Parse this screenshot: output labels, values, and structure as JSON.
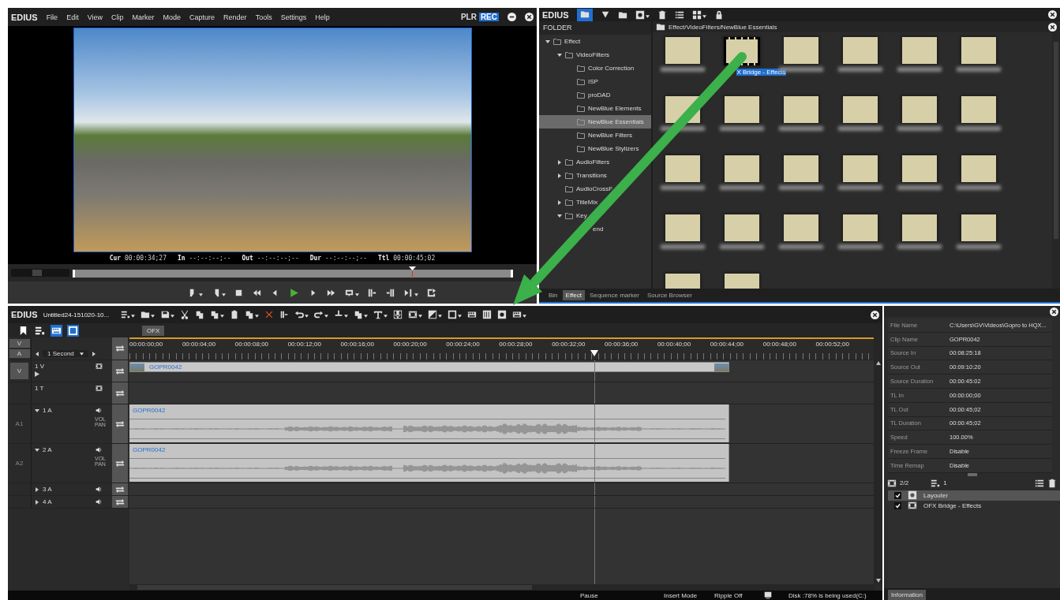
{
  "player": {
    "logo": "EDIUS",
    "menu": [
      "File",
      "Edit",
      "View",
      "Clip",
      "Marker",
      "Mode",
      "Capture",
      "Render",
      "Tools",
      "Settings",
      "Help"
    ],
    "modes": [
      {
        "label": "PLR",
        "selected": false
      },
      {
        "label": "REC",
        "selected": true
      }
    ],
    "timecodes": [
      {
        "label": "Cur",
        "value": "00:00:34;27"
      },
      {
        "label": "In",
        "value": "--:--:--;--"
      },
      {
        "label": "Out",
        "value": "--:--:--;--"
      },
      {
        "label": "Dur",
        "value": "--:--:--;--"
      },
      {
        "label": "Ttl",
        "value": "00:00:45;02"
      }
    ],
    "shuttle": {
      "level": 0.45
    },
    "scrubber": {
      "level": 0.77
    }
  },
  "bin": {
    "logo": "EDIUS",
    "folder_header": "FOLDER",
    "path": "Effect/VideoFilters/NewBlue Essentials",
    "tree": [
      {
        "label": "Effect",
        "expanded": true,
        "selected": false,
        "children": [
          {
            "label": "VideoFilters",
            "expanded": true,
            "selected": false,
            "children": [
              {
                "label": "Color Correction",
                "selected": false
              },
              {
                "label": "ISP",
                "selected": false
              },
              {
                "label": "proDAD",
                "selected": false
              },
              {
                "label": "NewBlue Elements",
                "selected": false
              },
              {
                "label": "NewBlue Essentials",
                "selected": true
              },
              {
                "label": "NewBlue Filters",
                "selected": false
              },
              {
                "label": "NewBlue Stylizers",
                "selected": false
              }
            ]
          },
          {
            "label": "AudioFilters",
            "expanded": false,
            "selected": false
          },
          {
            "label": "Transitions",
            "expanded": false,
            "selected": false
          },
          {
            "label": "AudioCrossF",
            "selected": false
          },
          {
            "label": "TitleMix",
            "expanded": false,
            "selected": false
          },
          {
            "label": "Key",
            "expanded": true,
            "selected": false,
            "children": [
              {
                "label": "end",
                "selected": false
              }
            ]
          }
        ]
      }
    ],
    "effects": [
      {
        "selected": false
      },
      {
        "label": "X Bridge - Effects",
        "selected": true
      },
      {
        "selected": false
      },
      {
        "selected": false
      },
      {
        "selected": false
      },
      {
        "selected": false
      },
      {
        "selected": false
      },
      {
        "selected": false
      },
      {
        "selected": false
      },
      {
        "selected": false
      },
      {
        "selected": false
      },
      {
        "selected": false
      },
      {
        "selected": false
      },
      {
        "selected": false
      },
      {
        "selected": false
      },
      {
        "selected": false
      },
      {
        "selected": false
      },
      {
        "selected": false
      },
      {
        "selected": false
      },
      {
        "selected": false
      },
      {
        "selected": false
      },
      {
        "selected": false
      },
      {
        "selected": false
      },
      {
        "selected": false
      },
      {
        "selected": false
      },
      {
        "selected": false
      }
    ],
    "tabs": [
      {
        "label": "Bin",
        "selected": false
      },
      {
        "label": "Effect",
        "selected": true
      },
      {
        "label": "Sequence marker",
        "selected": false
      },
      {
        "label": "Source Browser",
        "selected": false
      }
    ]
  },
  "timeline": {
    "logo": "EDIUS",
    "project": "Untitled24-151020-10...",
    "sequence_tab": "OFX",
    "track_switch": [
      {
        "label": "V",
        "on": true
      },
      {
        "label": "A",
        "on": true
      }
    ],
    "scale": "1 Second",
    "ruler": [
      "00:00:00;00",
      "00:00:04;00",
      "00:00:08;00",
      "00:00:12;00",
      "00:00:16;00",
      "00:00:20;00",
      "00:00:24;00",
      "00:00:28;00",
      "00:00:32;00",
      "00:00:36;00",
      "00:00:40;00",
      "00:00:44;00",
      "00:00:48;00",
      "00:00:52;00"
    ],
    "playhead": {
      "level": 0.625
    },
    "tracks": [
      {
        "kind": "video",
        "side": "V",
        "name": "1 V",
        "clip": "GOPR0042"
      },
      {
        "kind": "title",
        "name": "1 T"
      },
      {
        "kind": "audio",
        "side": "A1",
        "name": "1 A",
        "expanded": true,
        "mix": [
          "VOL",
          "PAN"
        ],
        "clip": "GOPR0042"
      },
      {
        "kind": "audio",
        "side": "A2",
        "name": "2 A",
        "expanded": true,
        "mix": [
          "VOL",
          "PAN"
        ],
        "clip": "GOPR0042"
      },
      {
        "kind": "audio",
        "name": "3 A",
        "expanded": false
      },
      {
        "kind": "audio",
        "name": "4 A",
        "expanded": false
      }
    ]
  },
  "status_bar": [
    "Pause",
    "Insert Mode",
    "Ripple Off",
    "Disk :78% is being used(C:)"
  ],
  "info": {
    "properties": [
      {
        "name": "File Name",
        "value": "C:\\Users\\GV\\Videos\\Gopro to HQX..."
      },
      {
        "name": "Clip Name",
        "value": "GOPR0042"
      },
      {
        "name": "Source In",
        "value": "00:08:25:18"
      },
      {
        "name": "Source Out",
        "value": "00:09:10:20"
      },
      {
        "name": "Source Duration",
        "value": "00:00:45:02"
      },
      {
        "name": "TL In",
        "value": "00:00:00;00"
      },
      {
        "name": "TL Out",
        "value": "00:00:45;02"
      },
      {
        "name": "TL Duration",
        "value": "00:00:45;02"
      },
      {
        "name": "Speed",
        "value": "100.00%"
      },
      {
        "name": "Freeze Frame",
        "value": "Disable"
      },
      {
        "name": "Time Remap",
        "value": "Disable"
      }
    ],
    "effect_count": "2/2",
    "keyframe_count": "1",
    "layers": [
      {
        "name": "Layouter",
        "checked": true,
        "selected": true
      },
      {
        "name": "OFX Bridge - Effects",
        "checked": true,
        "selected": false
      }
    ],
    "tab": "Information"
  }
}
